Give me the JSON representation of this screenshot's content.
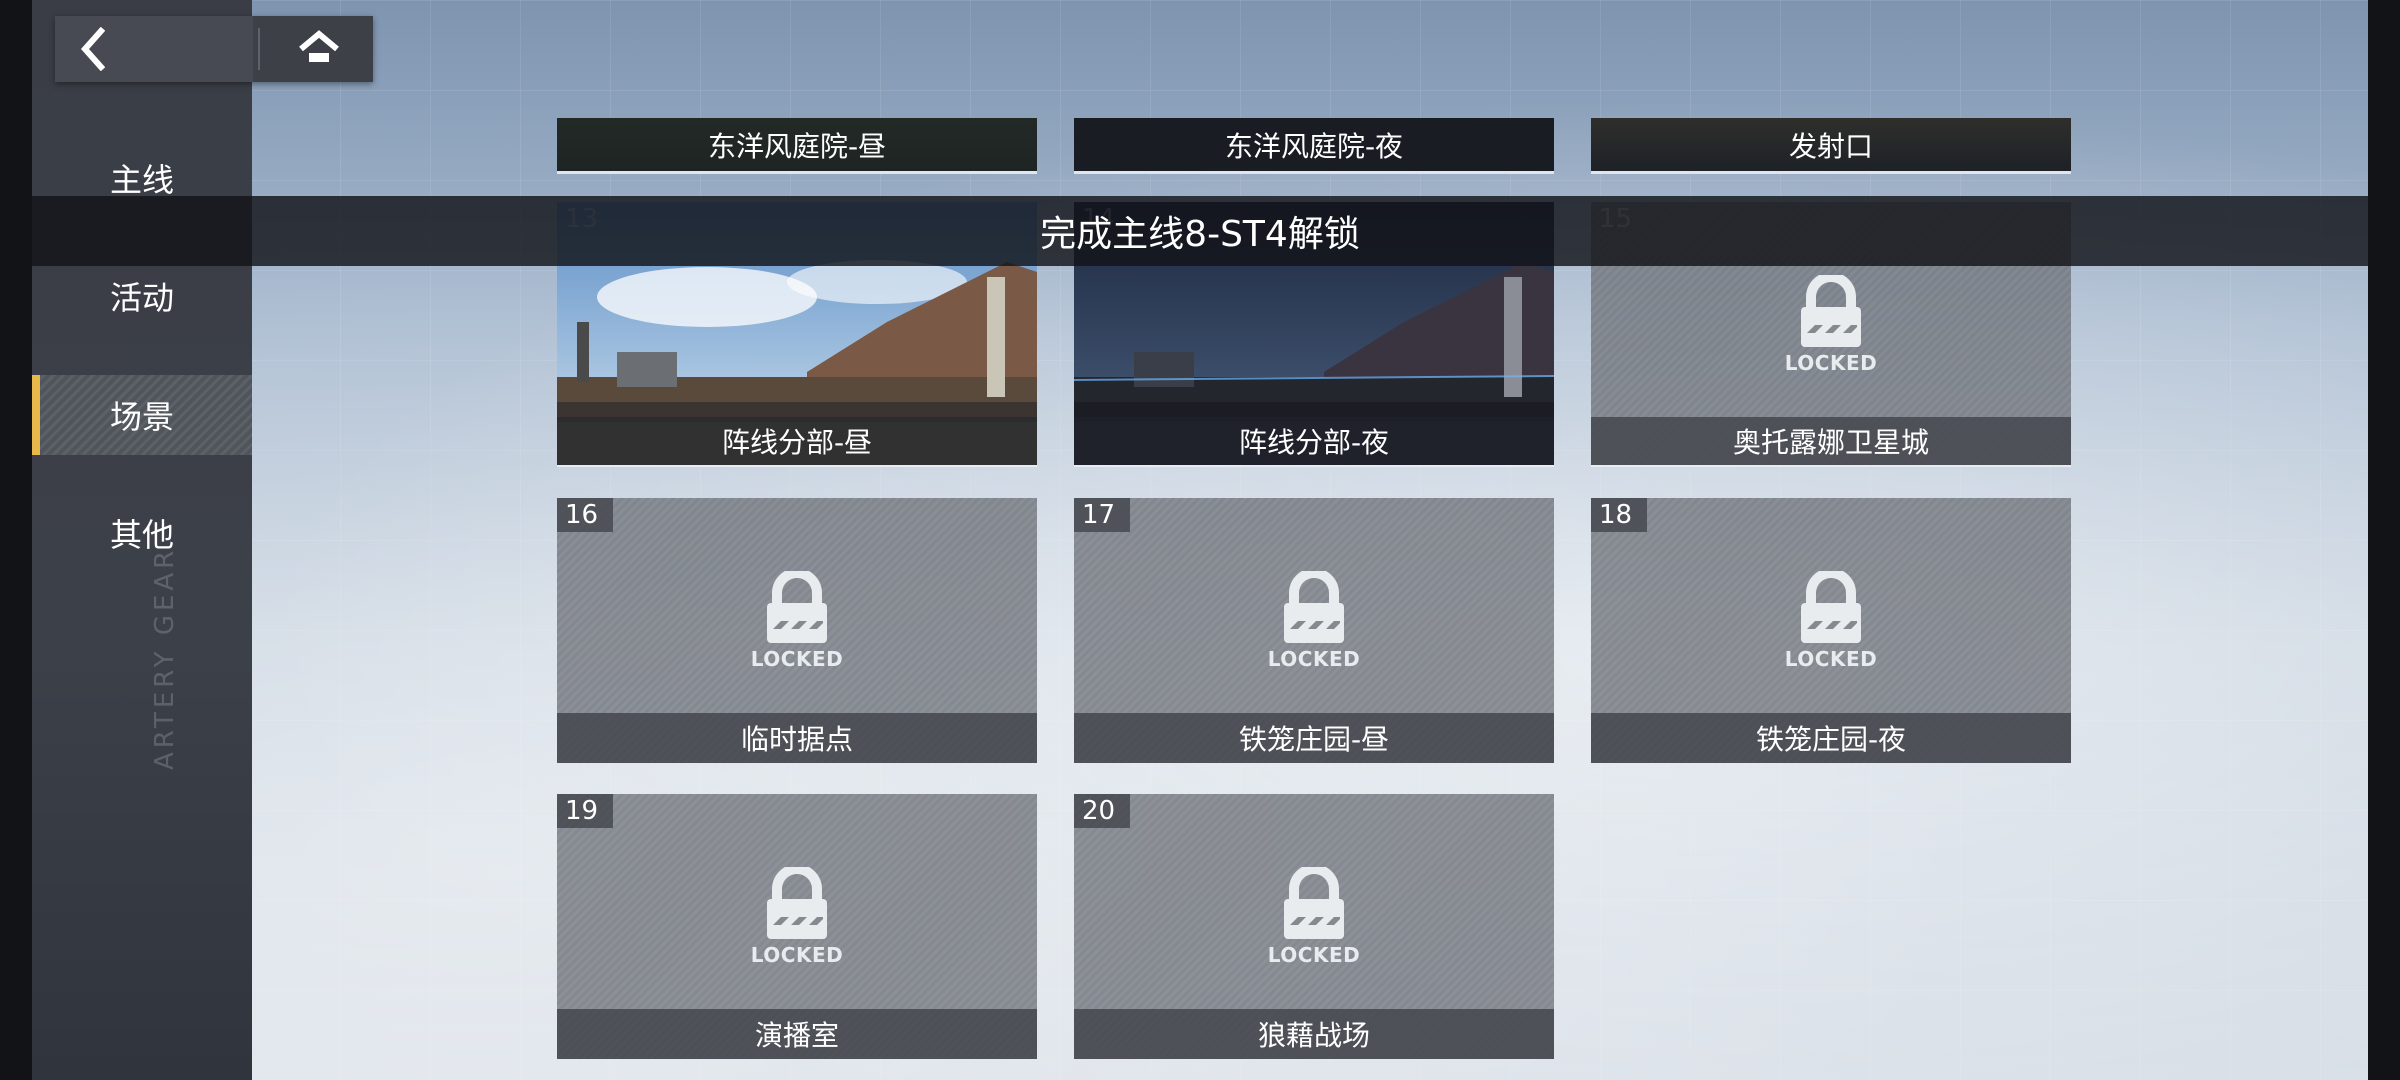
{
  "nav": {
    "back_icon": "chevron-left-icon",
    "home_icon": "home-icon",
    "items": [
      {
        "label": "主线",
        "active": false
      },
      {
        "label": "活动",
        "active": false
      },
      {
        "label": "场景",
        "active": true
      },
      {
        "label": "其他",
        "active": false
      }
    ]
  },
  "watermark": "ARTERY GEAR",
  "top_row": [
    {
      "title": "东洋风庭院-昼"
    },
    {
      "title": "东洋风庭院-夜"
    },
    {
      "title": "发射口"
    }
  ],
  "scenes": [
    {
      "number": "13",
      "title": "阵线分部-昼",
      "locked": false
    },
    {
      "number": "14",
      "title": "阵线分部-夜",
      "locked": false
    },
    {
      "number": "15",
      "title": "奥托露娜卫星城",
      "locked": true
    },
    {
      "number": "16",
      "title": "临时据点",
      "locked": true
    },
    {
      "number": "17",
      "title": "铁笼庄园-昼",
      "locked": true
    },
    {
      "number": "18",
      "title": "铁笼庄园-夜",
      "locked": true
    },
    {
      "number": "19",
      "title": "演播室",
      "locked": true
    },
    {
      "number": "20",
      "title": "狼藉战场",
      "locked": true
    }
  ],
  "lock_label": "LOCKED",
  "toast": "完成主线8-ST4解锁",
  "colors": {
    "accent": "#e8b94a",
    "card": "#6e727a"
  }
}
